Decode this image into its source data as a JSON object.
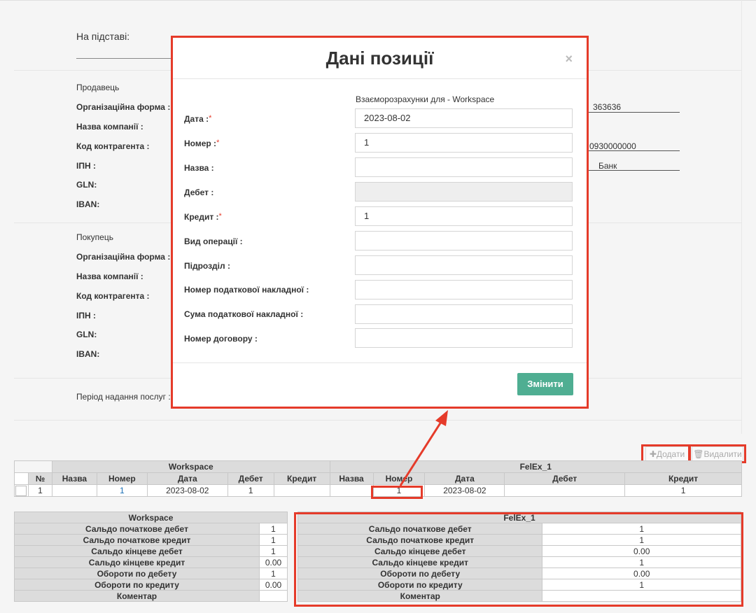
{
  "background": {
    "na_pidstavi": "На підставі:",
    "seller": {
      "title": "Продавець",
      "fields": [
        "Організаційна форма :",
        "Назва компанії :",
        "Код контрагента :",
        "ІПН :",
        "GLN:",
        "IBAN:"
      ],
      "right_values": [
        "363636",
        "0930000000",
        "Банк"
      ]
    },
    "buyer": {
      "title": "Покупець",
      "fields": [
        "Організаційна форма :",
        "Назва компанії :",
        "Код контрагента :",
        "ІПН :",
        "GLN:",
        "IBAN:"
      ]
    },
    "period_label": "Період надання послуг :"
  },
  "toolbar": {
    "add_label": "✚Додати",
    "delete_label": "🗑Видалити"
  },
  "grid": {
    "group1": "Workspace",
    "group2": "FelEx_1",
    "num_header": "№",
    "cols1": [
      "Назва",
      "Номер",
      "Дата",
      "Дебет",
      "Кредит"
    ],
    "cols2": [
      "Назва",
      "Номер",
      "Дата",
      "Дебет",
      "Кредит"
    ],
    "rows": [
      {
        "n": "1",
        "w_name": "",
        "w_num": "1",
        "w_date": "2023-08-02",
        "w_debit": "1",
        "w_credit": "",
        "f_name": "",
        "f_num": "1",
        "f_date": "2023-08-02",
        "f_debit": "",
        "f_credit": "1"
      }
    ]
  },
  "summary_left": {
    "header": "Workspace",
    "rows": [
      {
        "label": "Сальдо початкове дебет",
        "value": "1"
      },
      {
        "label": "Сальдо початкове кредит",
        "value": "1"
      },
      {
        "label": "Сальдо кінцеве дебет",
        "value": "1"
      },
      {
        "label": "Сальдо кінцеве кредит",
        "value": "0.00"
      },
      {
        "label": "Обороти по дебету",
        "value": "1"
      },
      {
        "label": "Обороти по кредиту",
        "value": "0.00"
      },
      {
        "label": "Коментар",
        "value": ""
      }
    ]
  },
  "summary_right": {
    "header": "FelEx_1",
    "rows": [
      {
        "label": "Сальдо початкове дебет",
        "value": "1"
      },
      {
        "label": "Сальдо початкове кредит",
        "value": "1"
      },
      {
        "label": "Сальдо кінцеве дебет",
        "value": "0.00"
      },
      {
        "label": "Сальдо кінцеве кредит",
        "value": "1"
      },
      {
        "label": "Обороти по дебету",
        "value": "0.00"
      },
      {
        "label": "Обороти по кредиту",
        "value": "1"
      },
      {
        "label": "Коментар",
        "value": ""
      }
    ]
  },
  "modal": {
    "title": "Дані позиції",
    "close": "×",
    "subtitle": "Взаєморозрахунки для - Workspace",
    "fields": [
      {
        "label": "Дата :",
        "value": "2023-08-02"
      },
      {
        "label": "Номер :",
        "value": "1"
      },
      {
        "label": "Назва :",
        "value": ""
      },
      {
        "label": "Дебет :",
        "value": ""
      },
      {
        "label": "Кредит :",
        "value": "1"
      },
      {
        "label": "Вид операції :",
        "value": ""
      },
      {
        "label": "Підрозділ :",
        "value": ""
      },
      {
        "label": "Номер податкової накладної :",
        "value": ""
      },
      {
        "label": "Сума податкової накладної :",
        "value": ""
      },
      {
        "label": "Номер договору :",
        "value": ""
      }
    ],
    "submit_label": "Змінити"
  },
  "colors": {
    "highlight": "#e53b2a",
    "primary_button": "#4fae92",
    "header_gray": "#dcdcdc",
    "link": "#1a6fb5"
  }
}
